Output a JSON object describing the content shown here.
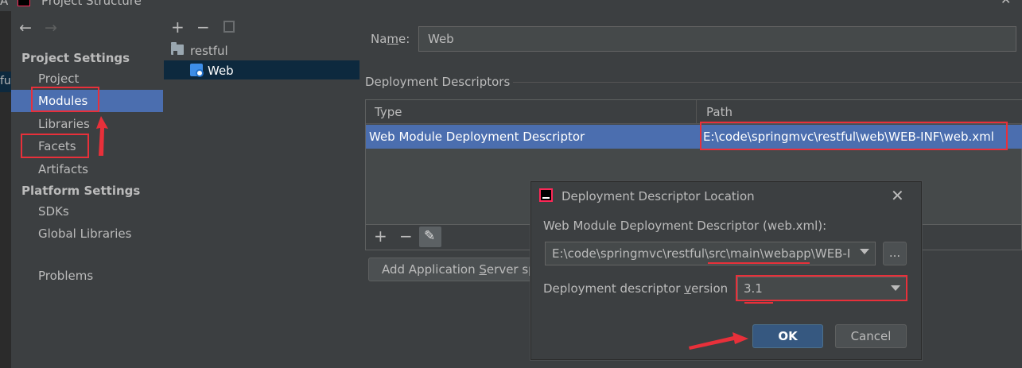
{
  "window": {
    "title": "Project Structure",
    "left_edge_fragment": "A"
  },
  "far_left": {
    "fragment": "fu"
  },
  "nav": {
    "back_icon": "arrow-left-icon",
    "forward_icon": "arrow-right-icon",
    "section_project": "Project Settings",
    "section_platform": "Platform Settings",
    "items": [
      {
        "label": "Project",
        "selected": false
      },
      {
        "label": "Modules",
        "selected": true
      },
      {
        "label": "Libraries",
        "selected": false
      },
      {
        "label": "Facets",
        "selected": false
      },
      {
        "label": "Artifacts",
        "selected": false
      },
      {
        "label": "SDKs",
        "selected": false
      },
      {
        "label": "Global Libraries",
        "selected": false
      },
      {
        "label": "Problems",
        "selected": false
      }
    ]
  },
  "module_tree": {
    "toolbar": {
      "add": "+",
      "remove": "−",
      "copy_icon": "copy-icon"
    },
    "root": "restful",
    "child": "Web"
  },
  "module": {
    "name_label_prefix": "Na",
    "name_label_mnemonic": "m",
    "name_label_suffix": "e:",
    "name_value": "Web",
    "deployment_descriptors_title": "Deployment Descriptors",
    "table": {
      "col_type": "Type",
      "col_path": "Path",
      "rows": [
        {
          "type": "Web Module Deployment Descriptor",
          "path": "E:\\code\\springmvc\\restful\\web\\WEB-INF\\web.xml"
        }
      ]
    },
    "table_toolbar": {
      "add": "+",
      "remove": "−",
      "edit_icon": "pencil-icon"
    },
    "add_server_prefix": "Add Application ",
    "add_server_mnemonic": "S",
    "add_server_suffix": "erver sp"
  },
  "dialog": {
    "title": "Deployment Descriptor Location",
    "label_path": "Web Module Deployment Descriptor (web.xml):",
    "path_value": "E:\\code\\springmvc\\restful\\src\\main\\webapp\\WEB-I",
    "browse": "...",
    "label_version_prefix": "Deployment descriptor ",
    "label_version_mnemonic": "v",
    "label_version_suffix": "ersion",
    "version_value": "3.1",
    "ok": "OK",
    "cancel": "Cancel"
  },
  "annotation_color": "#e8303a",
  "selection_color": "#4b6eaf"
}
